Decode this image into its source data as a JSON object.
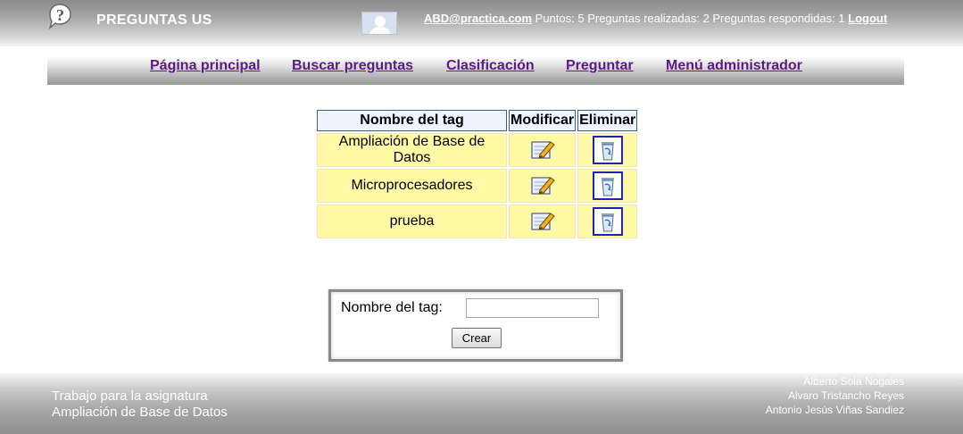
{
  "header": {
    "site_title": "PREGUNTAS US",
    "user_email": "ABD@practica.com",
    "stats_text": " Puntos: 5 Preguntas realizadas: 2 Preguntas respondidas: 1 ",
    "logout_label": "Logout",
    "logo_icon": "question-bubble-icon",
    "avatar_icon": "user-silhouette-icon"
  },
  "nav": {
    "items": [
      {
        "label": "Página principal"
      },
      {
        "label": "Buscar preguntas"
      },
      {
        "label": "Clasificación"
      },
      {
        "label": "Preguntar"
      },
      {
        "label": "Menú administrador"
      }
    ]
  },
  "tags_table": {
    "headers": [
      "Nombre del tag",
      "Modificar",
      "Eliminar"
    ],
    "rows": [
      {
        "name": "Ampliación de Base de Datos"
      },
      {
        "name": "Microprocesadores"
      },
      {
        "name": "prueba"
      }
    ],
    "edit_icon": "edit-pencil-icon",
    "delete_icon": "recycle-bin-icon"
  },
  "create_form": {
    "label": "Nombre del tag:",
    "input_value": "",
    "button_label": "Crear"
  },
  "footer": {
    "line1": "Trabajo para la asignatura",
    "line2": "Ampliación de Base de Datos",
    "authors": [
      "Alberto Sola Nogales",
      "Alvaro Tristancho Reyes",
      "Antonio Jesús Viñas Sandiez"
    ]
  },
  "colors": {
    "nav_link": "#5b1a86",
    "table_cell": "#fff9a6",
    "table_header": "#eef4fd",
    "delete_border": "#1f24b9"
  }
}
